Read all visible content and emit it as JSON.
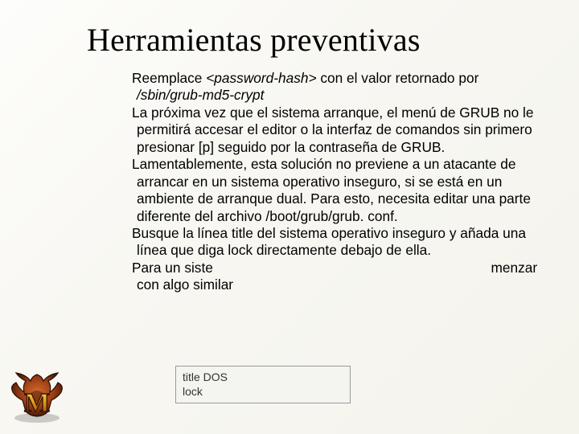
{
  "title": "Herramientas preventivas",
  "paragraphs": {
    "p1a": " Reemplace ",
    "p1_emph1": "<password-hash>",
    "p1b": " con el valor retornado por ",
    "p1_emph2": "/sbin/grub-md5-crypt",
    "p2": " La próxima vez que el sistema arranque, el menú de GRUB no le permitirá accesar el editor o la interfaz de comandos sin primero presionar [p] seguido por la contraseña de GRUB.",
    "p3": " Lamentablemente, esta solución no previene a un atacante de arrancar en un sistema operativo inseguro, si se está en un ambiente de arranque dual. Para esto, necesita editar una parte diferente del archivo /boot/grub/grub. conf.",
    "p4": " Busque la línea title del sistema operativo inseguro y añada una línea que diga lock directamente debajo de ella.",
    "p5a": " Para un siste",
    "p5b": "menzar con algo similar"
  },
  "codebox": {
    "line1": "title DOS",
    "line2": "lock"
  },
  "logo": {
    "letter": "M"
  }
}
